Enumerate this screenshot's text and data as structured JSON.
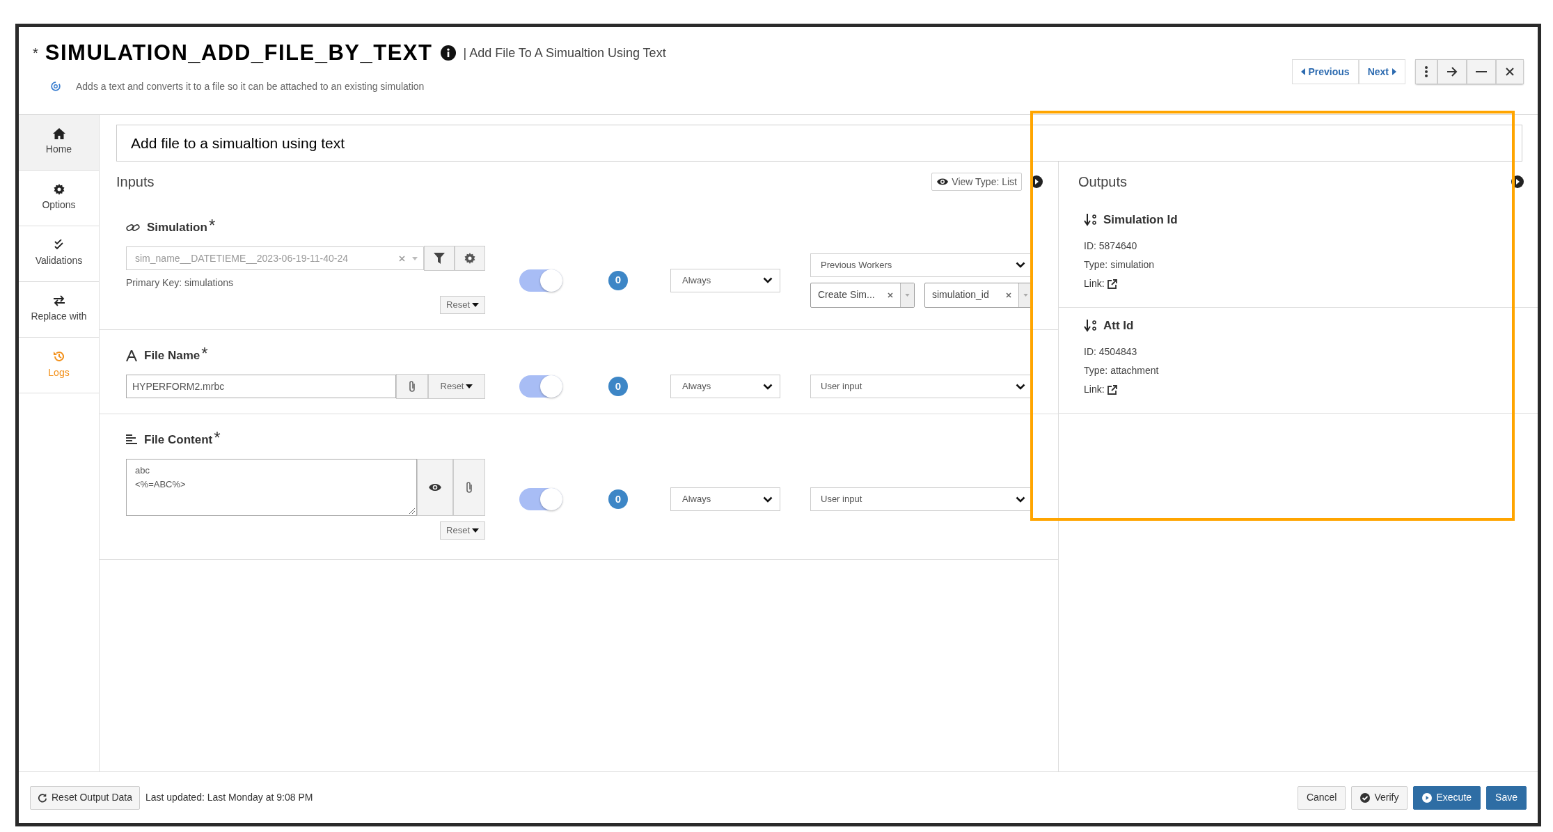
{
  "header": {
    "modified_mark": "*",
    "title": "SIMULATION_ADD_FILE_BY_TEXT",
    "subtitle": "| Add File To A Simualtion Using Text",
    "description": "Adds a text and converts it to a file so it can be attached to an existing simulation"
  },
  "nav_buttons": [
    {
      "label": "Previous",
      "kind": "prev"
    },
    {
      "label": "Next",
      "kind": "next"
    }
  ],
  "sidebar": {
    "items": [
      {
        "label": "Home",
        "kind": "home",
        "selected": true,
        "accent": false
      },
      {
        "label": "Options",
        "kind": "options",
        "selected": false,
        "accent": false
      },
      {
        "label": "Validations",
        "kind": "validations",
        "selected": false,
        "accent": false
      },
      {
        "label": "Replace with",
        "kind": "replace",
        "selected": false,
        "accent": false
      },
      {
        "label": "Logs",
        "kind": "logs",
        "selected": false,
        "accent": true
      }
    ]
  },
  "description_field": {
    "value": "Add file to a simualtion using text"
  },
  "inputs": {
    "title": "Inputs",
    "view_type": "View Type: List",
    "params": [
      {
        "kind": "lookup",
        "label": "Simulation",
        "required_mark": "*",
        "value": "sim_name__DATETIEME__2023-06-19-11-40-24",
        "note": "Primary Key: simulations",
        "reset": "Reset",
        "on": true,
        "count": "0",
        "condition": "Always",
        "source": "Previous Workers",
        "source_tags": [
          "Create Sim...",
          "simulation_id"
        ]
      },
      {
        "kind": "text",
        "label": "File Name",
        "required_mark": "*",
        "value": "HYPERFORM2.mrbc",
        "reset": "Reset",
        "on": true,
        "count": "0",
        "condition": "Always",
        "source": "User input"
      },
      {
        "kind": "textarea",
        "label": "File Content",
        "required_mark": "*",
        "value": "abc\n<%=ABC%>",
        "reset": "Reset",
        "on": true,
        "count": "0",
        "condition": "Always",
        "source": "User input"
      }
    ]
  },
  "outputs": {
    "title": "Outputs",
    "items": [
      {
        "name": "Simulation Id",
        "id": "ID: 5874640",
        "type": "Type: simulation",
        "link": "Link:"
      },
      {
        "name": "Att Id",
        "id": "ID: 4504843",
        "type": "Type: attachment",
        "link": "Link:"
      }
    ]
  },
  "footer": {
    "reset_button": "Reset Output Data",
    "last_updated": "Last updated: Last Monday at 9:08 PM",
    "buttons": [
      {
        "label": "Cancel",
        "kind": "cancel"
      },
      {
        "label": "Verify",
        "kind": "verify"
      },
      {
        "label": "Execute",
        "kind": "execute"
      },
      {
        "label": "Save",
        "kind": "save"
      }
    ]
  }
}
